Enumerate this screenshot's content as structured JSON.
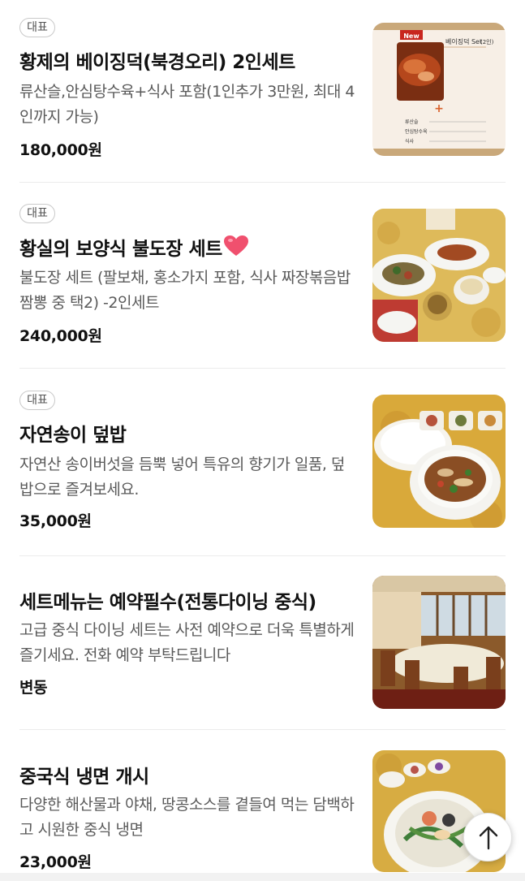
{
  "menu": {
    "items": [
      {
        "badge": "대표",
        "name": "황제의 베이징덕(북경오리) 2인세트",
        "description": "류산슬,안심탕수육+식사 포함(1인추가 3만원, 최대 4인까지 가능)",
        "price": "180,000원",
        "image": "peking-duck-menu-photo",
        "image_texts": {
          "new_tag": "New",
          "title": "베이징덕 Set",
          "title_sub": "(2인)",
          "row1": "류산슬",
          "row2": "안심탕수육",
          "row3": "식사"
        }
      },
      {
        "badge": "대표",
        "name": "황실의 보양식 불도장 세트",
        "emoji": "heart",
        "description": "불도장 세트 (팔보채, 홍소가지 포함, 식사 짜장볶음밥 짬뽕 중 택2) -2인세트",
        "price": "240,000원",
        "image": "buldojang-set-photo"
      },
      {
        "badge": "대표",
        "name": "자연송이 덮밥",
        "description": "자연산 송이버섯을 듬뿍 넣어 특유의 향기가 일품, 덮밥으로 즐겨보세요.",
        "price": "35,000원",
        "image": "pine-mushroom-rice-bowl-photo"
      },
      {
        "name": "세트메뉴는 예약필수(전통다이닝 중식)",
        "description": "고급 중식 다이닝 세트는 사전 예약으로 더욱 특별하게 즐기세요. 전화 예약 부탁드립니다",
        "price": "변동",
        "image": "dining-room-photo"
      },
      {
        "name": "중국식 냉면 개시",
        "description": "다양한 해산물과 야채, 땅콩소스를 곁들여 먹는 담백하고 시원한 중식 냉면",
        "price": "23,000원",
        "image": "chinese-cold-noodle-photo"
      }
    ]
  },
  "scroll_top_button": {
    "icon": "arrow-up-icon"
  },
  "colors": {
    "badge_border": "#c9c9c9",
    "description": "#5a5a5a",
    "heart": "#f0506e",
    "divider": "#ececec"
  }
}
